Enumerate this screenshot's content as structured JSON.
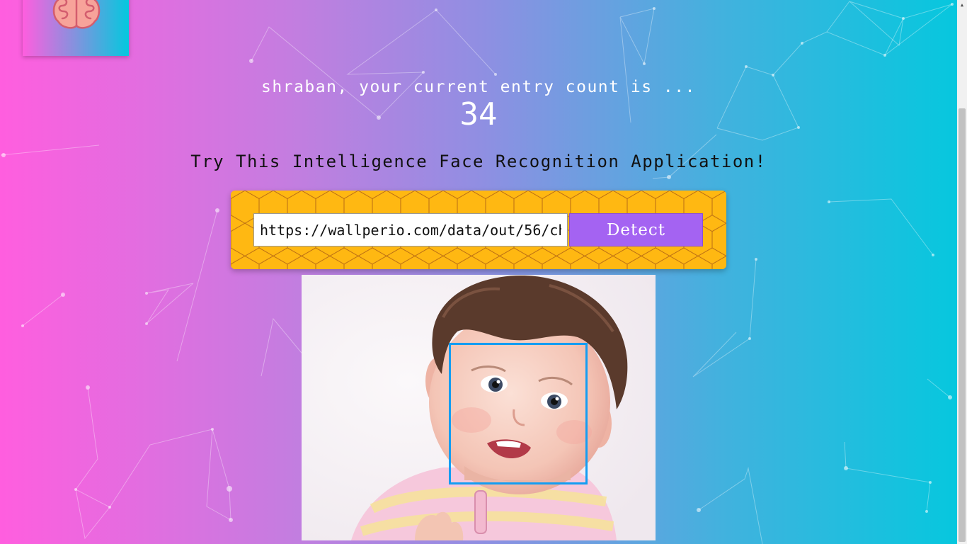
{
  "header": {
    "logo_icon": "brain-icon"
  },
  "rank": {
    "greeting": "shraban, your current entry count is ...",
    "count": "34"
  },
  "intro": {
    "text": "Try This Intelligence Face Recognition Application!"
  },
  "form": {
    "url_value": "https://wallperio.com/data/out/56/ch",
    "detect_label": "Detect"
  },
  "result": {
    "image_subject": "baby-photo",
    "face_boxes": 1
  },
  "colors": {
    "accent": "#a463f2",
    "panel": "#ffb812",
    "face_box": "#149df2"
  }
}
